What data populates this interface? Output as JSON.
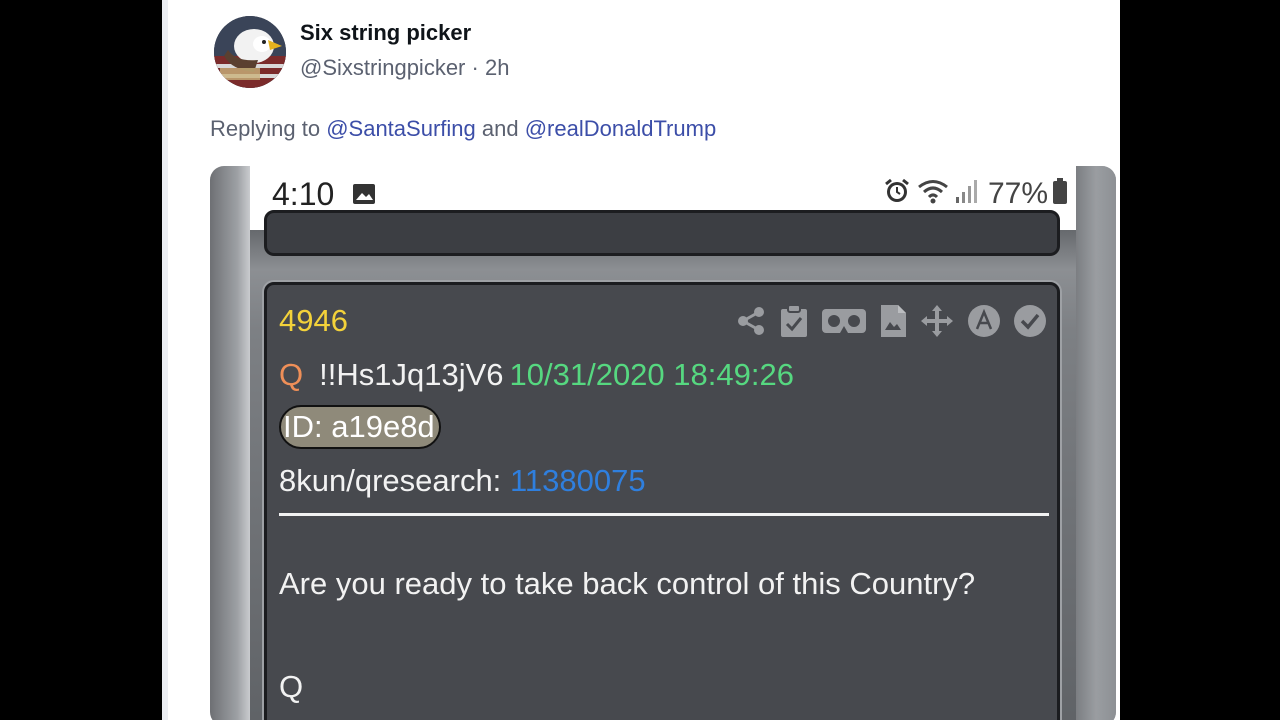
{
  "author": {
    "name": "Six string picker",
    "handle": "@Sixstringpicker",
    "separator": "·",
    "time": "2h",
    "avatar_icon": "eagle-flag-avatar"
  },
  "reply": {
    "prefix": "Replying to",
    "mention1": "@SantaSurfing",
    "conjunction": "and",
    "mention2": "@realDonaldTrump"
  },
  "phone": {
    "time": "4:10",
    "battery": "77%",
    "status_icons": [
      "gallery-icon",
      "alarm-icon",
      "wifi-icon",
      "signal-icon",
      "battery-icon"
    ]
  },
  "drop": {
    "number": "4946",
    "q_label": "Q",
    "tripcode": "!!Hs1Jq13jV6",
    "timestamp": "10/31/2020 18:49:26",
    "id": "ID: a19e8d",
    "board": "8kun/qresearch:",
    "board_post": "11380075",
    "message": "Are you ready to take back control of this Country?",
    "signature": "Q",
    "action_icons": [
      "share-icon",
      "clipboard-check-icon",
      "vr-goggles-icon",
      "document-icon",
      "move-icon",
      "archive-icon",
      "check-circle-icon"
    ]
  },
  "colors": {
    "post_number": "#f3d23a",
    "q_letter": "#ef8f58",
    "timestamp": "#56d880",
    "link": "#2f7fde",
    "mention": "#3c4ea8",
    "card_bg": "#47494e"
  }
}
